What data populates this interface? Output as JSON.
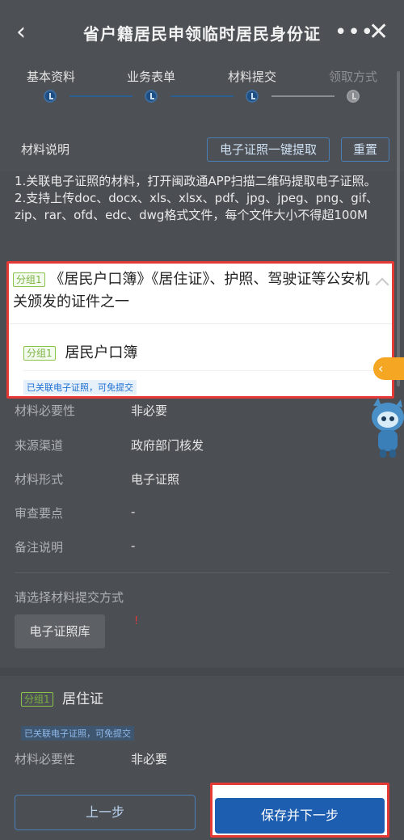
{
  "header": {
    "title": "省户籍居民申领临时居民身份证",
    "back_icon": "‹",
    "more_icon": "•••",
    "close_icon": "✕"
  },
  "steps": [
    {
      "label": "基本资料",
      "state": "done"
    },
    {
      "label": "业务表单",
      "state": "done"
    },
    {
      "label": "材料提交",
      "state": "current"
    },
    {
      "label": "领取方式",
      "state": "pending"
    }
  ],
  "materials": {
    "title": "材料说明",
    "extract_button": "电子证照一键提取",
    "reset_button": "重置",
    "notes": [
      "1.关联电子证照的材料，打开闽政通APP扫描二维码提取电子证照。",
      "2.支持上传doc、docx、xls、xlsx、pdf、jpg、jpeg、png、gif、zip、rar、ofd、edc、dwg格式文件，每个文件大小不得超100M"
    ]
  },
  "group_card": {
    "tag": "分组1",
    "title": "《居民户口簿》《居住证》、护照、驾驶证等公安机关颁发的证件之一",
    "item_tag": "分组1",
    "item_name": "居民户口簿",
    "linked_note": "已关联电子证照，可免提交"
  },
  "details": [
    {
      "label": "材料必要性",
      "value": "非必要"
    },
    {
      "label": "来源渠道",
      "value": "政府部门核发"
    },
    {
      "label": "材料形式",
      "value": "电子证照"
    },
    {
      "label": "审查要点",
      "value": "-"
    },
    {
      "label": "备注说明",
      "value": "-"
    }
  ],
  "submit": {
    "label": "请选择材料提交方式",
    "option": "电子证照库",
    "required_mark": "!"
  },
  "second_item": {
    "tag": "分组1",
    "name": "居住证",
    "linked_note": "已关联电子证照，可免提交",
    "necessity_label": "材料必要性",
    "necessity_value": "非必要"
  },
  "footer": {
    "prev_button": "上一步",
    "next_button": "保存并下一步"
  },
  "side_tab_icon": "‹",
  "colors": {
    "accent": "#1d5eb0",
    "highlight": "#e53935",
    "tag_green": "#7cb342",
    "side_tab": "#f5a623"
  }
}
